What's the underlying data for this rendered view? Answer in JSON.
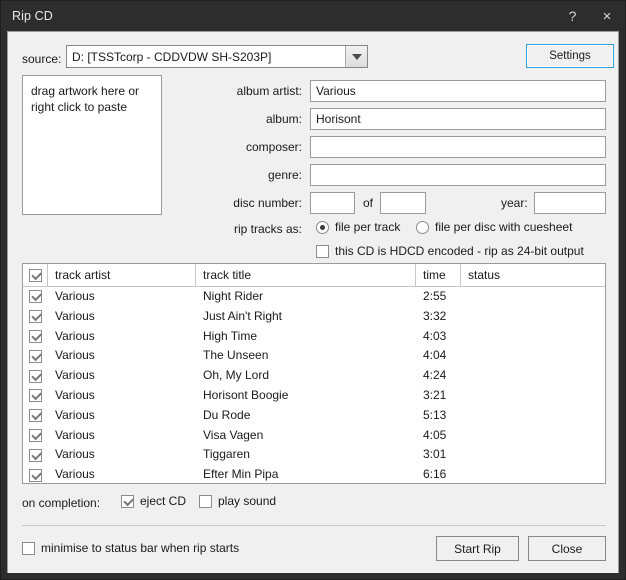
{
  "window": {
    "title": "Rip CD",
    "help_glyph": "?",
    "close_glyph": "×"
  },
  "source": {
    "label": "source:",
    "value": "D: [TSSTcorp - CDDVDW SH-S203P]",
    "settings_label": "Settings"
  },
  "artwork": {
    "placeholder": "drag artwork here or right click to paste"
  },
  "metadata": {
    "album_artist_label": "album artist:",
    "album_artist_value": "Various",
    "album_label": "album:",
    "album_value": "Horisont",
    "composer_label": "composer:",
    "composer_value": "",
    "genre_label": "genre:",
    "genre_value": "",
    "disc_number_label": "disc number:",
    "disc_number_value": "",
    "of_label": "of",
    "disc_total_value": "",
    "year_label": "year:",
    "year_value": ""
  },
  "rip_options": {
    "label": "rip tracks as:",
    "file_per_track_label": "file per track",
    "file_per_track_selected": true,
    "file_per_disc_label": "file per disc with cuesheet",
    "file_per_disc_selected": false,
    "hdcd_label": "this CD is HDCD encoded - rip as 24-bit output",
    "hdcd_checked": false
  },
  "tracklist": {
    "header_checked": true,
    "columns": [
      "track artist",
      "track title",
      "time",
      "status"
    ],
    "rows": [
      {
        "checked": true,
        "artist": "Various",
        "title": "Night Rider",
        "time": "2:55",
        "status": ""
      },
      {
        "checked": true,
        "artist": "Various",
        "title": "Just Ain't Right",
        "time": "3:32",
        "status": ""
      },
      {
        "checked": true,
        "artist": "Various",
        "title": "High Time",
        "time": "4:03",
        "status": ""
      },
      {
        "checked": true,
        "artist": "Various",
        "title": "The Unseen",
        "time": "4:04",
        "status": ""
      },
      {
        "checked": true,
        "artist": "Various",
        "title": "Oh, My Lord",
        "time": "4:24",
        "status": ""
      },
      {
        "checked": true,
        "artist": "Various",
        "title": "Horisont Boogie",
        "time": "3:21",
        "status": ""
      },
      {
        "checked": true,
        "artist": "Various",
        "title": "Du Rode",
        "time": "5:13",
        "status": ""
      },
      {
        "checked": true,
        "artist": "Various",
        "title": "Visa Vagen",
        "time": "4:05",
        "status": ""
      },
      {
        "checked": true,
        "artist": "Various",
        "title": "Tiggaren",
        "time": "3:01",
        "status": ""
      },
      {
        "checked": true,
        "artist": "Various",
        "title": "Efter Min Pipa",
        "time": "6:16",
        "status": ""
      }
    ]
  },
  "completion": {
    "label": "on completion:",
    "eject_label": "eject CD",
    "eject_checked": true,
    "play_sound_label": "play sound",
    "play_sound_checked": false
  },
  "footer": {
    "minimise_label": "minimise to status bar when rip starts",
    "minimise_checked": false,
    "start_rip_label": "Start Rip",
    "close_label": "Close"
  },
  "colors": {
    "titlebar_bg": "#2d2d2d",
    "client_bg": "#f0f0f0",
    "focus_blue": "#2e9fd8"
  }
}
